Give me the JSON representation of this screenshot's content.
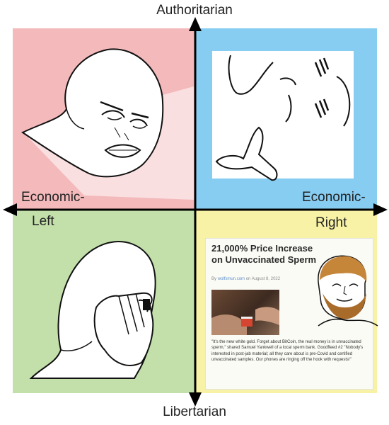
{
  "axes": {
    "top": "Authoritarian",
    "bottom": "Libertarian",
    "left": [
      "Economic-",
      "Left"
    ],
    "right": [
      "Economic-",
      "Right"
    ]
  },
  "colors": {
    "auth_left": "#f3b9bb",
    "auth_right": "#87cdf2",
    "lib_left": "#c3e0ab",
    "lib_right": "#f7f2a5"
  },
  "article": {
    "title": "21,000% Price Increase on Unvaccinated Sperm",
    "byline_prefix": "By",
    "site": "wolfsmun.com",
    "byline_suffix": "on August 8, 2022",
    "body": "\"It's the new white gold. Forget about BitCoin, the real money is in unvaccinated sperm,\" shared Samuel Yankwell of a local sperm bank. Goodfleed #2 \"Nobody's interested in post-jab material; all they care about is pre-Covid and certified unvaccinated samples. Our phones are ringing off the hook with requests!\""
  },
  "icons": {
    "auth_left": "angry-wojak-icon",
    "auth_right": "pointing-wojak-icon",
    "lib_left": "facepalm-wojak-icon",
    "lib_right": "bearded-chad-icon"
  }
}
